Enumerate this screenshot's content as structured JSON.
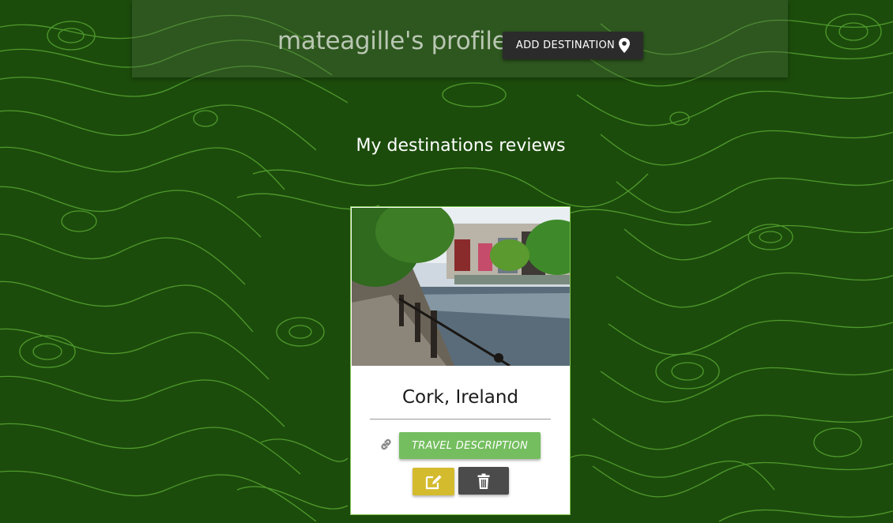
{
  "profile": {
    "title": "mateagille's profile",
    "add_destination_label": "ADD DESTINATION"
  },
  "section": {
    "title": "My destinations reviews"
  },
  "destinations": [
    {
      "name": "Cork, Ireland",
      "description_button_label": "TRAVEL DESCRIPTION"
    }
  ],
  "icons": {
    "add_destination": "map-marker-icon",
    "link": "link-icon",
    "edit": "edit-icon",
    "delete": "trash-icon"
  },
  "colors": {
    "background": "#1c4c0c",
    "contour_lines": "#58a832",
    "add_button": "#2b2b2b",
    "description_button": "#74be5f",
    "edit_button": "#d4bb2e",
    "delete_button": "#4b4b4b",
    "card_border": "#7cc24a"
  }
}
